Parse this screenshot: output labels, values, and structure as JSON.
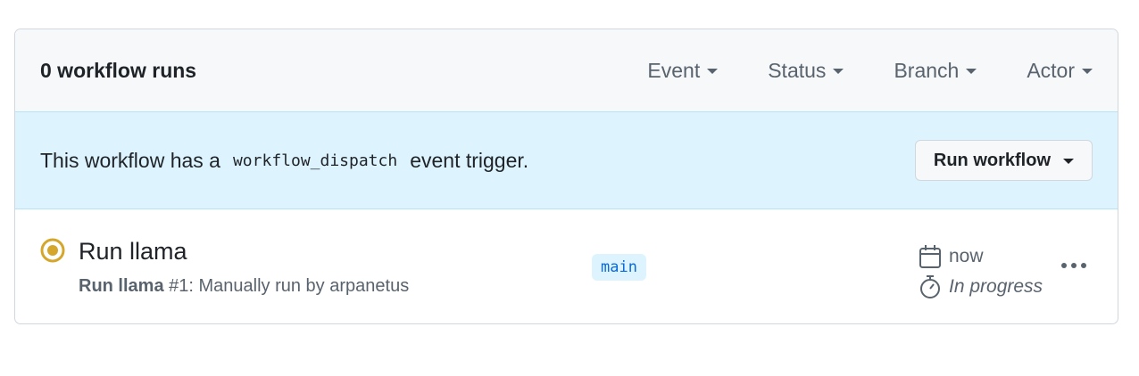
{
  "header": {
    "runs_count": "0 workflow runs",
    "filters": [
      "Event",
      "Status",
      "Branch",
      "Actor"
    ]
  },
  "dispatch": {
    "text_before": "This workflow has a",
    "code": "workflow_dispatch",
    "text_after": "event trigger.",
    "button_label": "Run workflow"
  },
  "run": {
    "title": "Run llama",
    "subtitle_name": "Run llama",
    "subtitle_rest": "#1: Manually run by arpanetus",
    "branch": "main",
    "time": "now",
    "duration": "In progress",
    "status_icon": "in-progress-icon",
    "status_color": "#d4a72c"
  },
  "colors": {
    "accent": "#0969da",
    "dispatch_bg": "#ddf4ff",
    "header_bg": "#f6f8fa"
  }
}
